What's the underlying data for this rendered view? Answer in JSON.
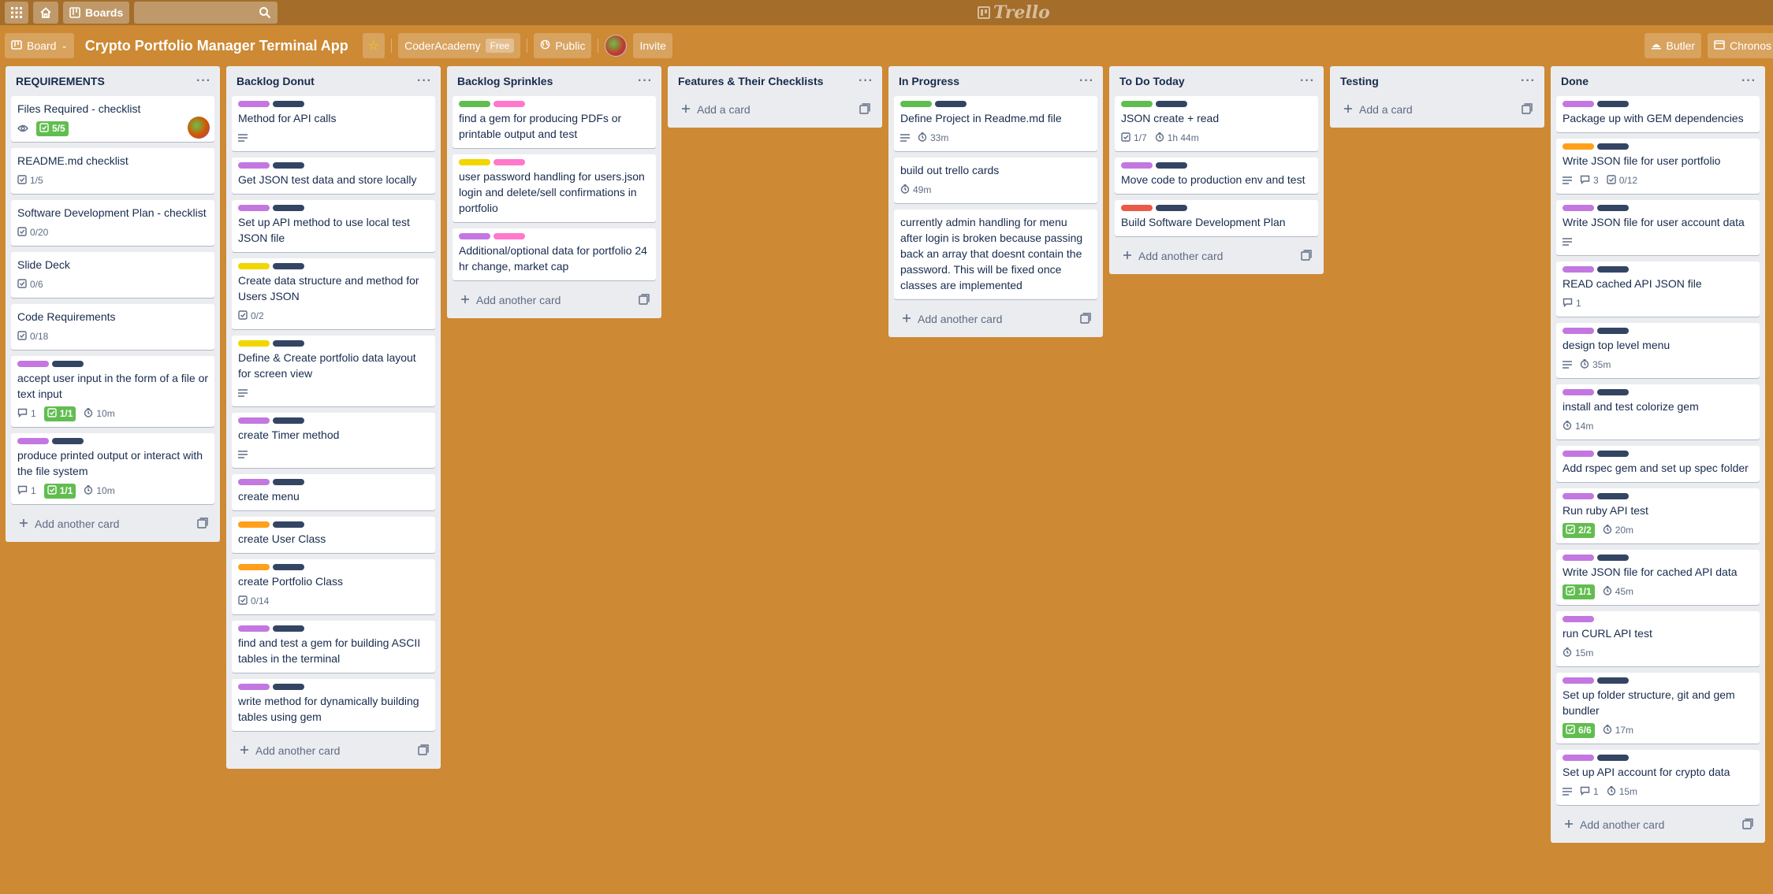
{
  "header": {
    "boards_label": "Boards",
    "logo_text": "Trello"
  },
  "board": {
    "view_label": "Board",
    "title": "Crypto Portfolio Manager Terminal App",
    "team": "CoderAcademy",
    "team_plan": "Free",
    "visibility": "Public",
    "invite_label": "Invite",
    "butler_label": "Butler",
    "chronos_label": "Chronos R"
  },
  "colors": {
    "board_bg": "#cd8933",
    "green": "#61bd4f",
    "purple": "#c377e0",
    "pink": "#ff78cb",
    "navy": "#344563",
    "yellow": "#f2d600",
    "orange": "#ff9f1a",
    "red": "#eb5a46"
  },
  "add_card_label": "Add another card",
  "add_a_card_label": "Add a card",
  "lists": [
    {
      "title": "REQUIREMENTS",
      "cards": [
        {
          "title": "Files Required - checklist",
          "labels": [],
          "watch": true,
          "check": "5/5",
          "check_done": true,
          "avatar": true
        },
        {
          "title": "README.md checklist",
          "labels": [],
          "check": "1/5"
        },
        {
          "title": "Software Development Plan - checklist",
          "labels": [],
          "check": "0/20"
        },
        {
          "title": "Slide Deck",
          "labels": [],
          "check": "0/6"
        },
        {
          "title": "Code Requirements",
          "labels": [],
          "check": "0/18"
        },
        {
          "title": "accept user input in the form of a file or text input",
          "labels": [
            "purple",
            "navy"
          ],
          "comments": "1",
          "check": "1/1",
          "check_done": true,
          "time": "10m"
        },
        {
          "title": "produce printed output or interact with the file system",
          "labels": [
            "purple",
            "navy"
          ],
          "comments": "1",
          "check": "1/1",
          "check_done": true,
          "time": "10m"
        }
      ],
      "add": "another"
    },
    {
      "title": "Backlog Donut",
      "cards": [
        {
          "title": "Method for API calls",
          "labels": [
            "purple",
            "navy"
          ],
          "desc": true
        },
        {
          "title": "Get JSON test data and store locally",
          "labels": [
            "purple",
            "navy"
          ]
        },
        {
          "title": "Set up API method to use local test JSON file",
          "labels": [
            "purple",
            "navy"
          ]
        },
        {
          "title": "Create data structure and method for Users JSON",
          "labels": [
            "yellow",
            "navy"
          ],
          "check": "0/2"
        },
        {
          "title": "Define & Create portfolio data layout for screen view",
          "labels": [
            "yellow",
            "navy"
          ],
          "desc": true
        },
        {
          "title": "create Timer method",
          "labels": [
            "purple",
            "navy"
          ],
          "desc": true
        },
        {
          "title": "create menu",
          "labels": [
            "purple",
            "navy"
          ]
        },
        {
          "title": "create User Class",
          "labels": [
            "orange",
            "navy"
          ]
        },
        {
          "title": "create Portfolio Class",
          "labels": [
            "orange",
            "navy"
          ],
          "check": "0/14"
        },
        {
          "title": "find and test a gem for building ASCII tables in the terminal",
          "labels": [
            "purple",
            "navy"
          ]
        },
        {
          "title": "write method for dynamically building tables using gem",
          "labels": [
            "purple",
            "navy"
          ]
        }
      ],
      "add": "another"
    },
    {
      "title": "Backlog Sprinkles",
      "cards": [
        {
          "title": "find a gem for producing PDFs or printable output and test",
          "labels": [
            "green",
            "pink"
          ]
        },
        {
          "title": "user password handling for users.json login and delete/sell confirmations in portfolio",
          "labels": [
            "yellow",
            "pink"
          ]
        },
        {
          "title": "Additional/optional data for portfolio 24 hr change, market cap",
          "labels": [
            "purple",
            "pink"
          ]
        }
      ],
      "add": "another"
    },
    {
      "title": "Features & Their Checklists",
      "cards": [],
      "add": "a"
    },
    {
      "title": "In Progress",
      "cards": [
        {
          "title": "Define Project in Readme.md file",
          "labels": [
            "green",
            "navy"
          ],
          "desc": true,
          "time": "33m"
        },
        {
          "title": "build out trello cards",
          "labels": [],
          "time": "49m"
        },
        {
          "title": "currently admin handling for menu after login is broken because passing back an array that doesnt contain the password. This will be fixed once classes are implemented",
          "labels": []
        }
      ],
      "add": "another"
    },
    {
      "title": "To Do Today",
      "cards": [
        {
          "title": "JSON create + read",
          "labels": [
            "green",
            "navy"
          ],
          "check": "1/7",
          "time": "1h 44m"
        },
        {
          "title": "Move code to production env and test",
          "labels": [
            "purple",
            "navy"
          ]
        },
        {
          "title": "Build Software Development Plan",
          "labels": [
            "red",
            "navy"
          ]
        }
      ],
      "add": "another"
    },
    {
      "title": "Testing",
      "cards": [],
      "add": "a"
    },
    {
      "title": "Done",
      "cards": [
        {
          "title": "Package up with GEM dependencies",
          "labels": [
            "purple",
            "navy"
          ]
        },
        {
          "title": "Write JSON file for user portfolio",
          "labels": [
            "orange",
            "navy"
          ],
          "desc": true,
          "comments": "3",
          "check": "0/12"
        },
        {
          "title": "Write JSON file for user account data",
          "labels": [
            "purple",
            "navy"
          ],
          "desc": true
        },
        {
          "title": "READ cached API JSON file",
          "labels": [
            "purple",
            "navy"
          ],
          "comments": "1"
        },
        {
          "title": "design top level menu",
          "labels": [
            "purple",
            "navy"
          ],
          "desc": true,
          "time": "35m"
        },
        {
          "title": "install and test colorize gem",
          "labels": [
            "purple",
            "navy"
          ],
          "time": "14m"
        },
        {
          "title": "Add rspec gem and set up spec folder",
          "labels": [
            "purple",
            "navy"
          ]
        },
        {
          "title": "Run ruby API test",
          "labels": [
            "purple",
            "navy"
          ],
          "check": "2/2",
          "check_done": true,
          "time": "20m"
        },
        {
          "title": "Write JSON file for cached API data",
          "labels": [
            "purple",
            "navy"
          ],
          "check": "1/1",
          "check_done": true,
          "time": "45m"
        },
        {
          "title": "run CURL API test",
          "labels": [
            "purple"
          ],
          "time": "15m"
        },
        {
          "title": "Set up folder structure, git and gem bundler",
          "labels": [
            "purple",
            "navy"
          ],
          "check": "6/6",
          "check_done": true,
          "time": "17m"
        },
        {
          "title": "Set up API account for crypto data",
          "labels": [
            "purple",
            "navy"
          ],
          "desc": true,
          "comments": "1",
          "time": "15m"
        }
      ],
      "add": "another"
    }
  ]
}
